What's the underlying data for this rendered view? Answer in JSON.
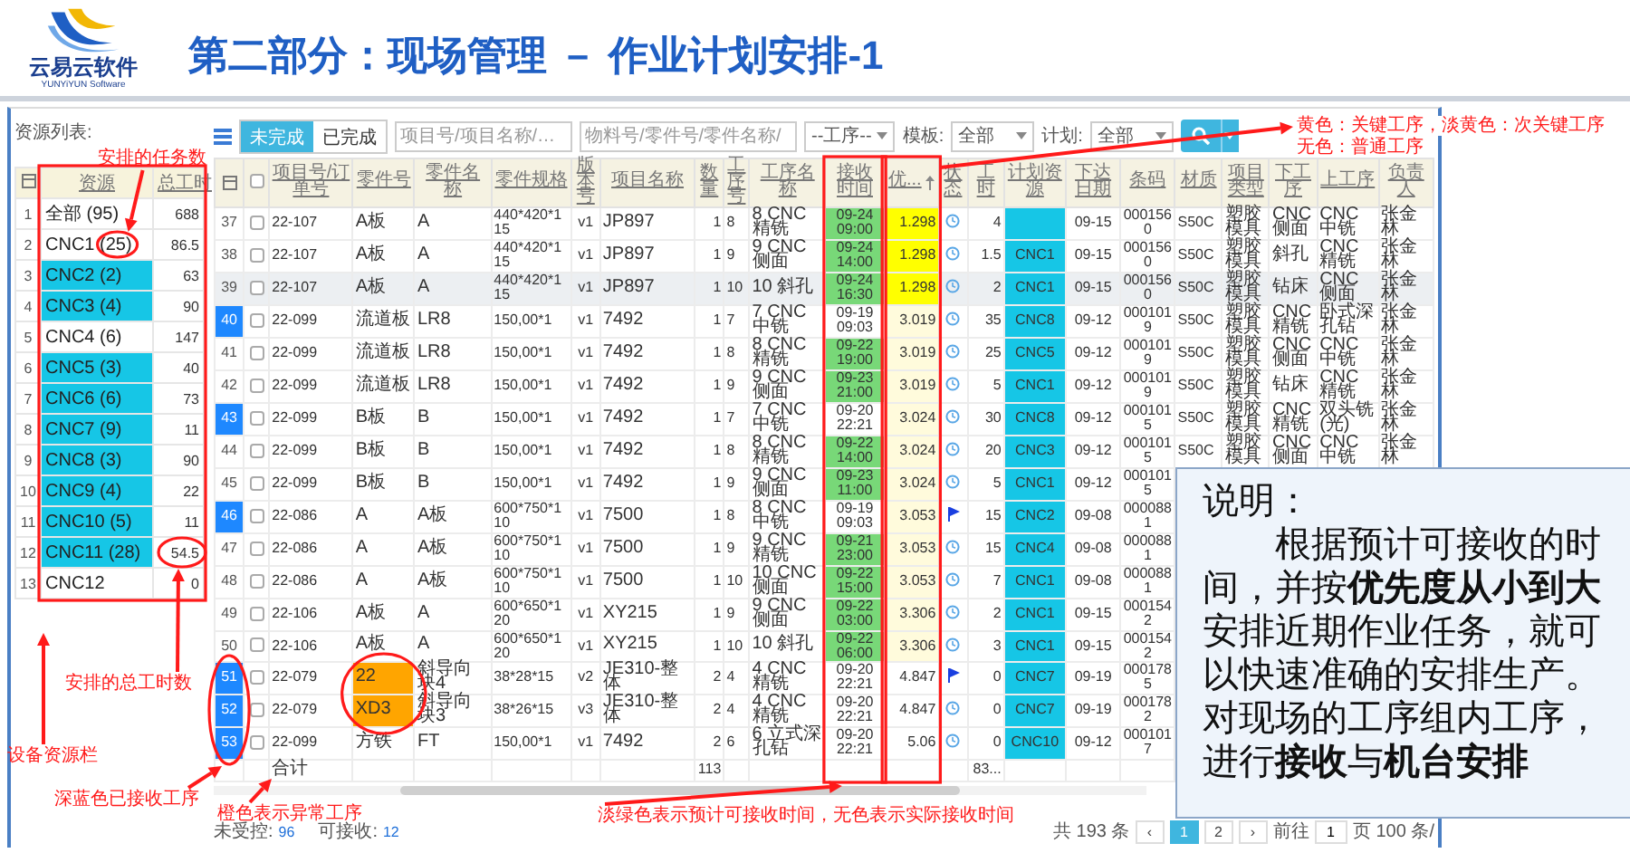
{
  "logo": {
    "name": "云易云软件",
    "tagline": "YUNYiYUN Software"
  },
  "title": "第二部分：现场管理 － 作业计划安排-1",
  "resources": {
    "label": "资源列表:",
    "columns": [
      "资源",
      "总工时"
    ],
    "rows": [
      {
        "index": "1",
        "name": "全部 (95)",
        "hours": "688",
        "highlighted": false
      },
      {
        "index": "2",
        "name": "CNC1 (25)",
        "hours": "86.5",
        "highlighted": false
      },
      {
        "index": "3",
        "name": "CNC2 (2)",
        "hours": "63",
        "highlighted": true
      },
      {
        "index": "4",
        "name": "CNC3 (4)",
        "hours": "90",
        "highlighted": true
      },
      {
        "index": "5",
        "name": "CNC4 (6)",
        "hours": "147",
        "highlighted": false
      },
      {
        "index": "6",
        "name": "CNC5 (3)",
        "hours": "40",
        "highlighted": true
      },
      {
        "index": "7",
        "name": "CNC6 (6)",
        "hours": "73",
        "highlighted": true
      },
      {
        "index": "8",
        "name": "CNC7 (9)",
        "hours": "11",
        "highlighted": true
      },
      {
        "index": "9",
        "name": "CNC8 (3)",
        "hours": "90",
        "highlighted": true
      },
      {
        "index": "10",
        "name": "CNC9 (4)",
        "hours": "22",
        "highlighted": true
      },
      {
        "index": "11",
        "name": "CNC10 (5)",
        "hours": "11",
        "highlighted": true
      },
      {
        "index": "12",
        "name": "CNC11 (28)",
        "hours": "54.5",
        "highlighted": true
      },
      {
        "index": "13",
        "name": "CNC12",
        "hours": "0",
        "highlighted": false
      }
    ]
  },
  "toolbar": {
    "tabs": [
      {
        "label": "未完成",
        "selected": true
      },
      {
        "label": "已完成",
        "selected": false
      }
    ],
    "filters": [
      {
        "kind": "input",
        "placeholder": "项目号/项目名称/…"
      },
      {
        "kind": "input",
        "placeholder": "物料号/零件号/零件名称/"
      },
      {
        "kind": "select",
        "value": "--工序--"
      },
      {
        "kind": "select",
        "label": "模板:",
        "value": "全部"
      },
      {
        "kind": "select",
        "label": "计划:",
        "value": "全部"
      }
    ]
  },
  "table": {
    "all_checked": false,
    "columns": [
      "项目号/订单号",
      "零件号",
      "零件名称",
      "零件规格",
      "版本号",
      "项目名称",
      "数量",
      "工序号",
      "工序名称",
      "接收时间",
      "优...",
      "状态",
      "工时",
      "计划资源",
      "下达日期",
      "条码",
      "材质",
      "项目类型",
      "下工序",
      "上工序",
      "负责人"
    ],
    "rows": [
      {
        "index": "37",
        "received": false,
        "hovered": false,
        "abnormal": false,
        "order": "22-107",
        "part_no": "A板",
        "part_name": "A",
        "spec": "440*420*115",
        "version": "v1",
        "project": "JP897",
        "qty": "1",
        "op_no": "8",
        "op_name": "8 CNC 精铣",
        "receive": {
          "time": "09-24 09:00",
          "estimated": true
        },
        "priority": {
          "value": "1.298",
          "kind": "key"
        },
        "status": {
          "kind": "pending"
        },
        "hours": "4",
        "issue_date": "09-15",
        "barcode": "0001560",
        "material": "S50C",
        "project_type": "塑胶模具",
        "next_op": "CNC 侧面",
        "prev_op": "CNC 中铣",
        "owner": "张金林"
      },
      {
        "index": "38",
        "received": false,
        "hovered": false,
        "abnormal": false,
        "order": "22-107",
        "part_no": "A板",
        "part_name": "A",
        "spec": "440*420*115",
        "version": "v1",
        "project": "JP897",
        "qty": "1",
        "op_no": "9",
        "op_name": "9 CNC 侧面",
        "receive": {
          "time": "09-24 14:00",
          "estimated": true
        },
        "priority": {
          "value": "1.298",
          "kind": "key"
        },
        "status": {
          "kind": "pending"
        },
        "hours": "1.5",
        "resource": "CNC1",
        "issue_date": "09-15",
        "barcode": "0001560",
        "material": "S50C",
        "project_type": "塑胶模具",
        "next_op": "斜孔",
        "prev_op": "CNC 精铣",
        "owner": "张金林"
      },
      {
        "index": "39",
        "received": false,
        "hovered": true,
        "abnormal": false,
        "order": "22-107",
        "part_no": "A板",
        "part_name": "A",
        "spec": "440*420*115",
        "version": "v1",
        "project": "JP897",
        "qty": "1",
        "op_no": "10",
        "op_name": "10 斜孔",
        "receive": {
          "time": "09-24 16:30",
          "estimated": true
        },
        "priority": {
          "value": "1.298",
          "kind": "key"
        },
        "status": {
          "kind": "pending"
        },
        "hours": "2",
        "resource": "CNC1",
        "issue_date": "09-15",
        "barcode": "0001560",
        "material": "S50C",
        "project_type": "塑胶模具",
        "next_op": "钻床",
        "prev_op": "CNC 侧面",
        "owner": "张金林"
      },
      {
        "index": "40",
        "received": true,
        "hovered": false,
        "abnormal": false,
        "order": "22-099",
        "part_no": "流道板",
        "part_name": "LR8",
        "spec": "150,00*1",
        "version": "v1",
        "project": "7492",
        "qty": "1",
        "op_no": "7",
        "op_name": "7 CNC 中铣",
        "receive": {
          "time": "09-19 09:03",
          "estimated": false
        },
        "priority": {
          "value": "3.019",
          "kind": "secondary"
        },
        "status": {
          "kind": "pending"
        },
        "hours": "35",
        "resource": "CNC8",
        "issue_date": "09-12",
        "barcode": "0001019",
        "material": "S50C",
        "project_type": "塑胶模具",
        "next_op": "CNC 精铣",
        "prev_op": "卧式深孔钻",
        "owner": "张金林"
      },
      {
        "index": "41",
        "received": false,
        "hovered": false,
        "abnormal": false,
        "order": "22-099",
        "part_no": "流道板",
        "part_name": "LR8",
        "spec": "150,00*1",
        "version": "v1",
        "project": "7492",
        "qty": "1",
        "op_no": "8",
        "op_name": "8 CNC 精铣",
        "receive": {
          "time": "09-22 19:00",
          "estimated": true
        },
        "priority": {
          "value": "3.019",
          "kind": "secondary"
        },
        "status": {
          "kind": "pending"
        },
        "hours": "25",
        "resource": "CNC5",
        "issue_date": "09-12",
        "barcode": "0001019",
        "material": "S50C",
        "project_type": "塑胶模具",
        "next_op": "CNC 侧面",
        "prev_op": "CNC 中铣",
        "owner": "张金林"
      },
      {
        "index": "42",
        "received": false,
        "hovered": false,
        "abnormal": false,
        "order": "22-099",
        "part_no": "流道板",
        "part_name": "LR8",
        "spec": "150,00*1",
        "version": "v1",
        "project": "7492",
        "qty": "1",
        "op_no": "9",
        "op_name": "9 CNC 侧面",
        "receive": {
          "time": "09-23 21:00",
          "estimated": true
        },
        "priority": {
          "value": "3.019",
          "kind": "secondary"
        },
        "status": {
          "kind": "pending"
        },
        "hours": "5",
        "resource": "CNC1",
        "issue_date": "09-12",
        "barcode": "0001019",
        "material": "S50C",
        "project_type": "塑胶模具",
        "next_op": "钻床",
        "prev_op": "CNC 精铣",
        "owner": "张金林"
      },
      {
        "index": "43",
        "received": true,
        "hovered": false,
        "abnormal": false,
        "order": "22-099",
        "part_no": "B板",
        "part_name": "B",
        "spec": "150,00*1",
        "version": "v1",
        "project": "7492",
        "qty": "1",
        "op_no": "7",
        "op_name": "7 CNC 中铣",
        "receive": {
          "time": "09-20 22:21",
          "estimated": false
        },
        "priority": {
          "value": "3.024",
          "kind": "secondary"
        },
        "status": {
          "kind": "pending"
        },
        "hours": "30",
        "resource": "CNC8",
        "issue_date": "09-12",
        "barcode": "0001015",
        "material": "S50C",
        "project_type": "塑胶模具",
        "next_op": "CNC 精铣",
        "prev_op": "双头铣(光)",
        "owner": "张金林"
      },
      {
        "index": "44",
        "received": false,
        "hovered": false,
        "abnormal": false,
        "order": "22-099",
        "part_no": "B板",
        "part_name": "B",
        "spec": "150,00*1",
        "version": "v1",
        "project": "7492",
        "qty": "1",
        "op_no": "8",
        "op_name": "8 CNC 精铣",
        "receive": {
          "time": "09-22 14:00",
          "estimated": true
        },
        "priority": {
          "value": "3.024",
          "kind": "secondary"
        },
        "status": {
          "kind": "pending"
        },
        "hours": "20",
        "resource": "CNC3",
        "issue_date": "09-12",
        "barcode": "0001015",
        "material": "S50C",
        "project_type": "塑胶模具",
        "next_op": "CNC 侧面",
        "prev_op": "CNC 中铣",
        "owner": "张金林"
      },
      {
        "index": "45",
        "received": false,
        "hovered": false,
        "abnormal": false,
        "order": "22-099",
        "part_no": "B板",
        "part_name": "B",
        "spec": "150,00*1",
        "version": "v1",
        "project": "7492",
        "qty": "1",
        "op_no": "9",
        "op_name": "9 CNC 侧面",
        "receive": {
          "time": "09-23 11:00",
          "estimated": true
        },
        "priority": {
          "value": "3.024",
          "kind": "secondary"
        },
        "status": {
          "kind": "pending"
        },
        "hours": "5",
        "resource": "CNC1",
        "issue_date": "09-12",
        "barcode": "0001015"
      },
      {
        "index": "46",
        "received": true,
        "hovered": false,
        "abnormal": false,
        "order": "22-086",
        "part_no": "A",
        "part_name": "A板",
        "spec": "600*750*110",
        "version": "v1",
        "project": "7500",
        "qty": "1",
        "op_no": "8",
        "op_name": "8 CNC 中铣",
        "receive": {
          "time": "09-19 09:03",
          "estimated": false
        },
        "priority": {
          "value": "3.053",
          "kind": "secondary"
        },
        "status": {
          "kind": "flagged"
        },
        "hours": "15",
        "resource": "CNC2",
        "issue_date": "09-08",
        "barcode": "0000881"
      },
      {
        "index": "47",
        "received": false,
        "hovered": false,
        "abnormal": false,
        "order": "22-086",
        "part_no": "A",
        "part_name": "A板",
        "spec": "600*750*110",
        "version": "v1",
        "project": "7500",
        "qty": "1",
        "op_no": "9",
        "op_name": "9 CNC 精铣",
        "receive": {
          "time": "09-21 23:00",
          "estimated": true
        },
        "priority": {
          "value": "3.053",
          "kind": "secondary"
        },
        "status": {
          "kind": "pending"
        },
        "hours": "15",
        "resource": "CNC4",
        "issue_date": "09-08",
        "barcode": "0000881"
      },
      {
        "index": "48",
        "received": false,
        "hovered": false,
        "abnormal": false,
        "order": "22-086",
        "part_no": "A",
        "part_name": "A板",
        "spec": "600*750*110",
        "version": "v1",
        "project": "7500",
        "qty": "1",
        "op_no": "10",
        "op_name": "10 CNC 侧面",
        "receive": {
          "time": "09-22 15:00",
          "estimated": true
        },
        "priority": {
          "value": "3.053",
          "kind": "secondary"
        },
        "status": {
          "kind": "pending"
        },
        "hours": "7",
        "resource": "CNC1",
        "issue_date": "09-08",
        "barcode": "0000881"
      },
      {
        "index": "49",
        "received": false,
        "hovered": false,
        "abnormal": false,
        "order": "22-106",
        "part_no": "A板",
        "part_name": "A",
        "spec": "600*650*120",
        "version": "v1",
        "project": "XY215",
        "qty": "1",
        "op_no": "9",
        "op_name": "9 CNC 侧面",
        "receive": {
          "time": "09-22 03:00",
          "estimated": true
        },
        "priority": {
          "value": "3.306",
          "kind": "secondary"
        },
        "status": {
          "kind": "pending"
        },
        "hours": "2",
        "resource": "CNC1",
        "issue_date": "09-15",
        "barcode": "0001542"
      },
      {
        "index": "50",
        "received": false,
        "hovered": false,
        "abnormal": false,
        "order": "22-106",
        "part_no": "A板",
        "part_name": "A",
        "spec": "600*650*120",
        "version": "v1",
        "project": "XY215",
        "qty": "1",
        "op_no": "10",
        "op_name": "10 斜孔",
        "receive": {
          "time": "09-22 06:00",
          "estimated": true
        },
        "priority": {
          "value": "3.306",
          "kind": "secondary"
        },
        "status": {
          "kind": "pending"
        },
        "hours": "3",
        "resource": "CNC1",
        "issue_date": "09-15",
        "barcode": "0001542"
      },
      {
        "index": "51",
        "received": true,
        "hovered": false,
        "abnormal": true,
        "order": "22-079",
        "part_no": "22",
        "part_name": "斜导向块4",
        "spec": "38*28*15",
        "version": "v2",
        "project": "JE310-整体",
        "qty": "2",
        "op_no": "4",
        "op_name": "4 CNC 精铣",
        "receive": {
          "time": "09-20 22:21",
          "estimated": false
        },
        "priority": {
          "value": "4.847",
          "kind": "normal"
        },
        "status": {
          "kind": "flagged"
        },
        "hours": "0",
        "resource": "CNC7",
        "issue_date": "09-19",
        "barcode": "0001785"
      },
      {
        "index": "52",
        "received": true,
        "hovered": false,
        "abnormal": true,
        "order": "22-079",
        "part_no": "XD3",
        "part_name": "斜导向块3",
        "spec": "38*26*15",
        "version": "v3",
        "project": "JE310-整体",
        "qty": "2",
        "op_no": "4",
        "op_name": "4 CNC 精铣",
        "receive": {
          "time": "09-20 22:21",
          "estimated": false
        },
        "priority": {
          "value": "4.847",
          "kind": "normal"
        },
        "status": {
          "kind": "pending"
        },
        "hours": "0",
        "resource": "CNC7",
        "issue_date": "09-19",
        "barcode": "0001782"
      },
      {
        "index": "53",
        "received": true,
        "hovered": false,
        "abnormal": false,
        "order": "22-099",
        "part_no": "方铁",
        "part_name": "FT",
        "spec": "150,00*1",
        "version": "v1",
        "project": "7492",
        "qty": "2",
        "op_no": "6",
        "op_name": "6 立式深孔钻",
        "receive": {
          "time": "09-20 22:21",
          "estimated": false
        },
        "priority": {
          "value": "5.06",
          "kind": "normal"
        },
        "status": {
          "kind": "pending"
        },
        "hours": "0",
        "resource": "CNC10",
        "issue_date": "09-12",
        "barcode": "0001017"
      }
    ],
    "totals": {
      "order": "合计",
      "qty": "113",
      "hours": "83..."
    }
  },
  "footer": {
    "stats": [
      {
        "label": "未受控:",
        "value": "96"
      },
      {
        "label": "可接收:",
        "value": "12"
      }
    ],
    "total": "共 193 条",
    "prev": "‹",
    "pages": [
      {
        "label": "1",
        "selected": true
      },
      {
        "label": "2",
        "selected": false
      }
    ],
    "next": "›",
    "jump_label": "前往",
    "jump_value": "1",
    "jump_unit": "页",
    "page_size": "100 条/"
  },
  "note": {
    "title": "说明：",
    "text": "根据预计可接收的时间，并按**优先度从小到大**安排近期作业任务，就可以快速准确的安排生产。对现场的工序组内工序，进行**接收**与**机台安排**"
  },
  "annotations": [
    "安排的任务数",
    "安排的总工时数",
    "设备资源栏",
    "深蓝色已接收工序",
    "橙色表示异常工序",
    "淡绿色表示预计可接收时间，无色表示实际接收时间",
    "黄色：关键工序，淡黄色：次关键工序",
    "无色：普通工序"
  ]
}
